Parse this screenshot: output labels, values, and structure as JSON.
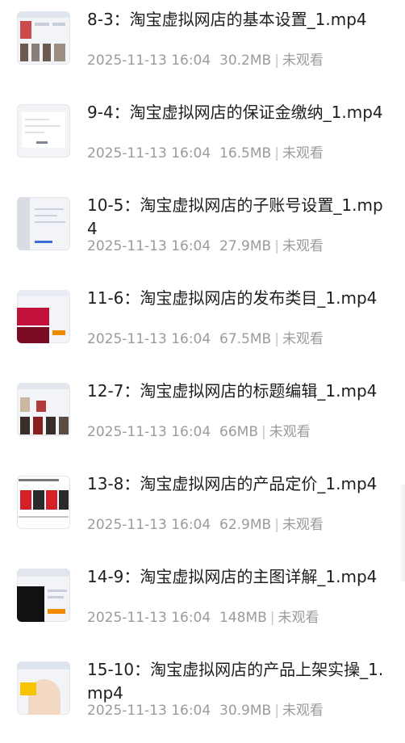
{
  "videos": [
    {
      "title": "8-3：淘宝虚拟网店的基本设置_1.mp4",
      "date": "2025-11-13 16:04",
      "size": "30.2MB",
      "status": "未观看"
    },
    {
      "title": "9-4：淘宝虚拟网店的保证金缴纳_1.mp4",
      "date": "2025-11-13 16:04",
      "size": "16.5MB",
      "status": "未观看"
    },
    {
      "title": "10-5：淘宝虚拟网店的子账号设置_1.mp4",
      "date": "2025-11-13 16:04",
      "size": "27.9MB",
      "status": "未观看"
    },
    {
      "title": "11-6：淘宝虚拟网店的发布类目_1.mp4",
      "date": "2025-11-13 16:04",
      "size": "67.5MB",
      "status": "未观看"
    },
    {
      "title": "12-7：淘宝虚拟网店的标题编辑_1.mp4",
      "date": "2025-11-13 16:04",
      "size": "66MB",
      "status": "未观看"
    },
    {
      "title": "13-8：淘宝虚拟网店的产品定价_1.mp4",
      "date": "2025-11-13 16:04",
      "size": "62.9MB",
      "status": "未观看"
    },
    {
      "title": "14-9：淘宝虚拟网店的主图详解_1.mp4",
      "date": "2025-11-13 16:04",
      "size": "148MB",
      "status": "未观看"
    },
    {
      "title": "15-10：淘宝虚拟网店的产品上架实操_1.mp4",
      "date": "2025-11-13 16:04",
      "size": "30.9MB",
      "status": "未观看"
    }
  ]
}
